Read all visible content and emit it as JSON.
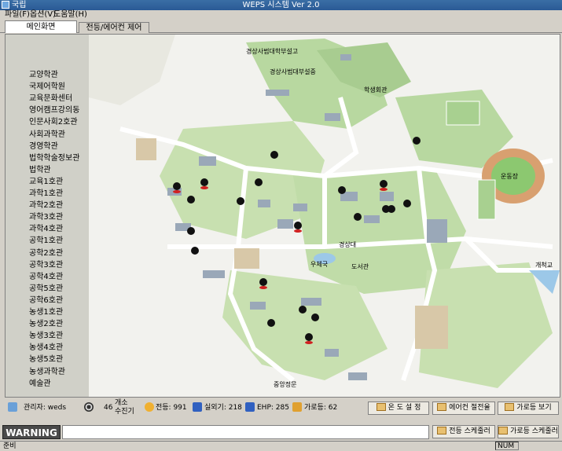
{
  "window": {
    "app_name": "국립",
    "title": "WEPS 시스템 Ver 2.0"
  },
  "menu": [
    "파일(F)",
    "옵션(V)",
    "도움말(H)"
  ],
  "tabs": [
    "메인화면",
    "전등/에어컨 제어"
  ],
  "buildings": [
    "교양학관",
    "국제어학원",
    "교육문화센터",
    "영어캠프강의동",
    "인문사회2호관",
    "사회과학관",
    "경영학관",
    "법학학술정보관",
    "법학관",
    "교육1호관",
    "과학1호관",
    "과학2호관",
    "과학3호관",
    "과학4호관",
    "공학1호관",
    "공학2호관",
    "공학3호관",
    "공학4호관",
    "공학5호관",
    "공학6호관",
    "농생1호관",
    "농생2호관",
    "농생3호관",
    "농생4호관",
    "농생5호관",
    "농생과학관",
    "예술관"
  ],
  "map_labels": {
    "top": "경상사범대학부설고",
    "top2": "경상사범대부설중",
    "gym": "운동장",
    "center": "경상대",
    "front": "중앙정문",
    "library": "도서관",
    "pond": "우체국",
    "east": "개척교",
    "road": "학생회관"
  },
  "status": {
    "admin_label": "관리자: weds",
    "count_value": "46",
    "count_label1": "개소",
    "count_label2": "수진기",
    "lights": "전등: 991",
    "outdoor": "실외기: 218",
    "ehp": "EHP: 285",
    "street": "가로등: 62",
    "temp_btn": "온 도 설 정",
    "ac_btn": "에어컨 절전율",
    "street_btn": "가로등 보기",
    "light_sched_btn": "전등 스케줄러",
    "street_sched_btn": "가로등 스케줄러"
  },
  "warning": "WARNING",
  "bottom": {
    "ready": "준비",
    "num": "NUM"
  }
}
